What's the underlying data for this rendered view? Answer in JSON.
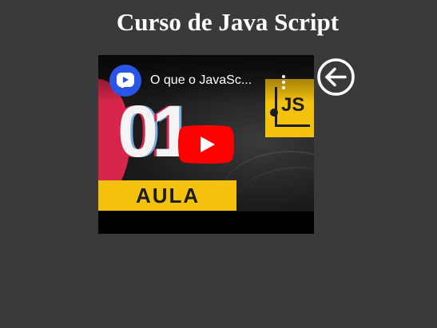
{
  "page": {
    "title": "Curso de Java Script",
    "background_color": "#3a3a3a"
  },
  "video": {
    "title": "O que o JavaSc...",
    "thumbnail": {
      "number_text": "01",
      "band_text": "AULA",
      "logo_text": "JS",
      "accent_color": "#f4c20d",
      "red_color": "#d8264a"
    },
    "channel_avatar_icon": "channel-logo-icon",
    "play_button_color": "#ff0000",
    "more_icon": "more-vert-icon"
  },
  "nav": {
    "back_icon": "arrow-left-circle-icon"
  }
}
